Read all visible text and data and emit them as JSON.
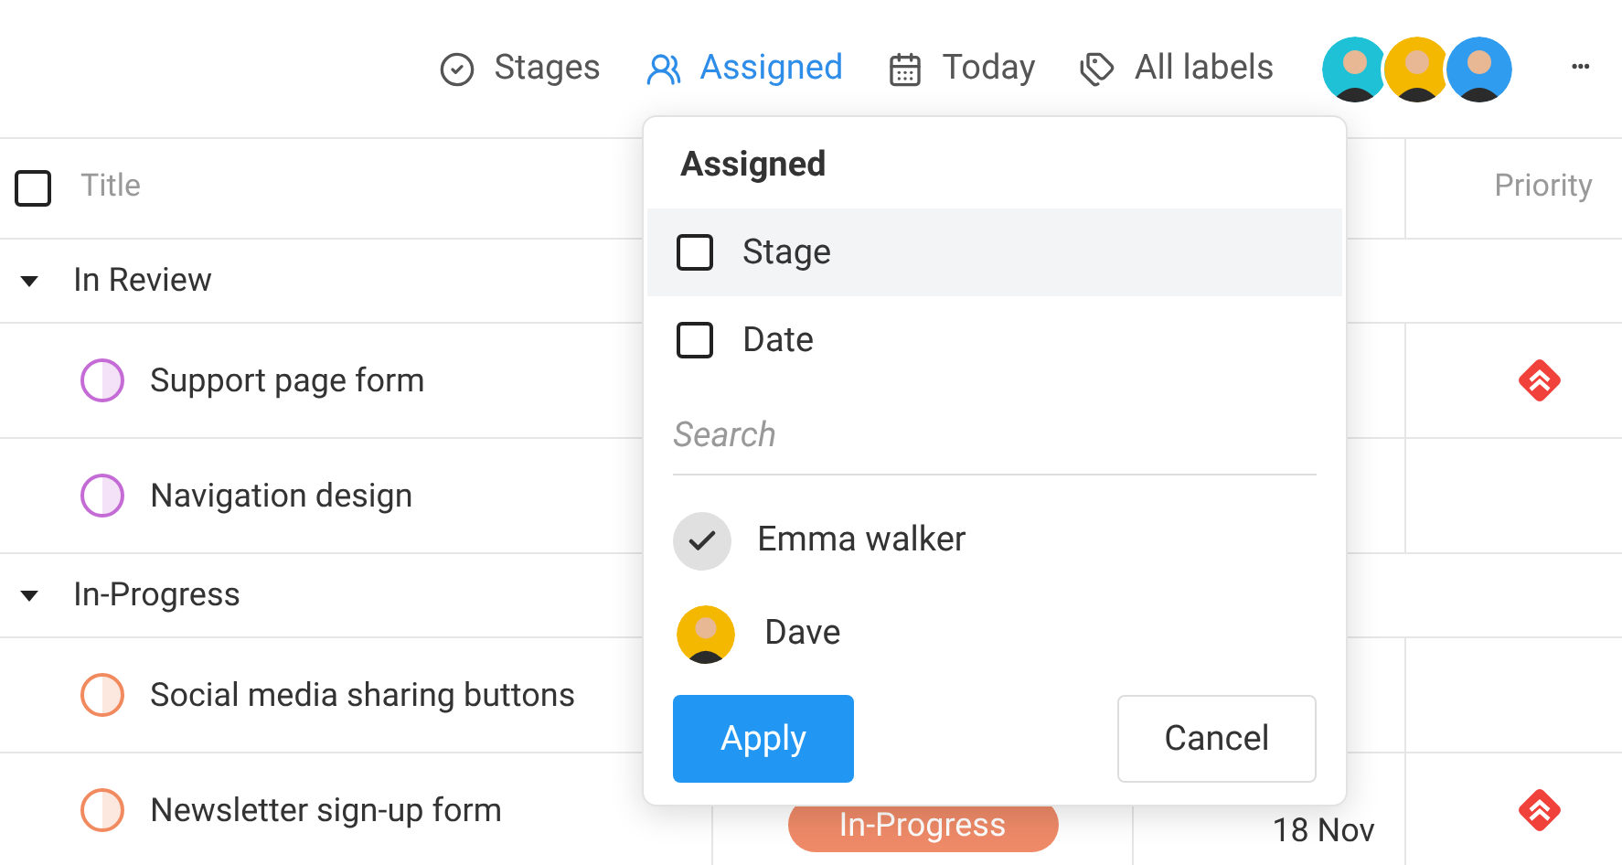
{
  "toolbar": {
    "filters": [
      {
        "label": "Stages",
        "selected": false
      },
      {
        "label": "Assigned",
        "selected": true
      },
      {
        "label": "Today",
        "selected": false
      },
      {
        "label": "All labels",
        "selected": false
      }
    ],
    "avatars": [
      {
        "color": "#1fc1d6"
      },
      {
        "color": "#f5b800"
      },
      {
        "color": "#2f9cf0"
      }
    ],
    "more": "•••"
  },
  "table": {
    "select_all": {
      "checked": false
    },
    "columns": [
      {
        "label": "Title"
      },
      {
        "label": "Priority"
      }
    ],
    "groups": [
      {
        "name": "In Review",
        "expanded": true,
        "rows": [
          {
            "title": "Support page form",
            "color": "#c56bd6",
            "urgent": true
          },
          {
            "title": "Navigation design",
            "color": "#c56bd6",
            "urgent": false
          }
        ]
      },
      {
        "name": "In-Progress",
        "expanded": true,
        "rows": [
          {
            "title": "Social media sharing buttons",
            "color": "#f28a5f",
            "urgent": false
          },
          {
            "title": "Newsletter sign-up form",
            "color": "#f28a5f",
            "stage": "In-Progress",
            "date": "18 Nov",
            "urgent": true
          }
        ]
      }
    ]
  },
  "popup": {
    "title": "Assigned",
    "options": [
      {
        "label": "Stage",
        "checked": false,
        "highlighted": true
      },
      {
        "label": "Date",
        "checked": false,
        "highlighted": false
      }
    ],
    "search": {
      "placeholder": "Search"
    },
    "people": [
      {
        "name": "Emma walker",
        "checked": true
      },
      {
        "name": "Dave",
        "checked": false
      }
    ],
    "apply": "Apply",
    "cancel": "Cancel"
  }
}
